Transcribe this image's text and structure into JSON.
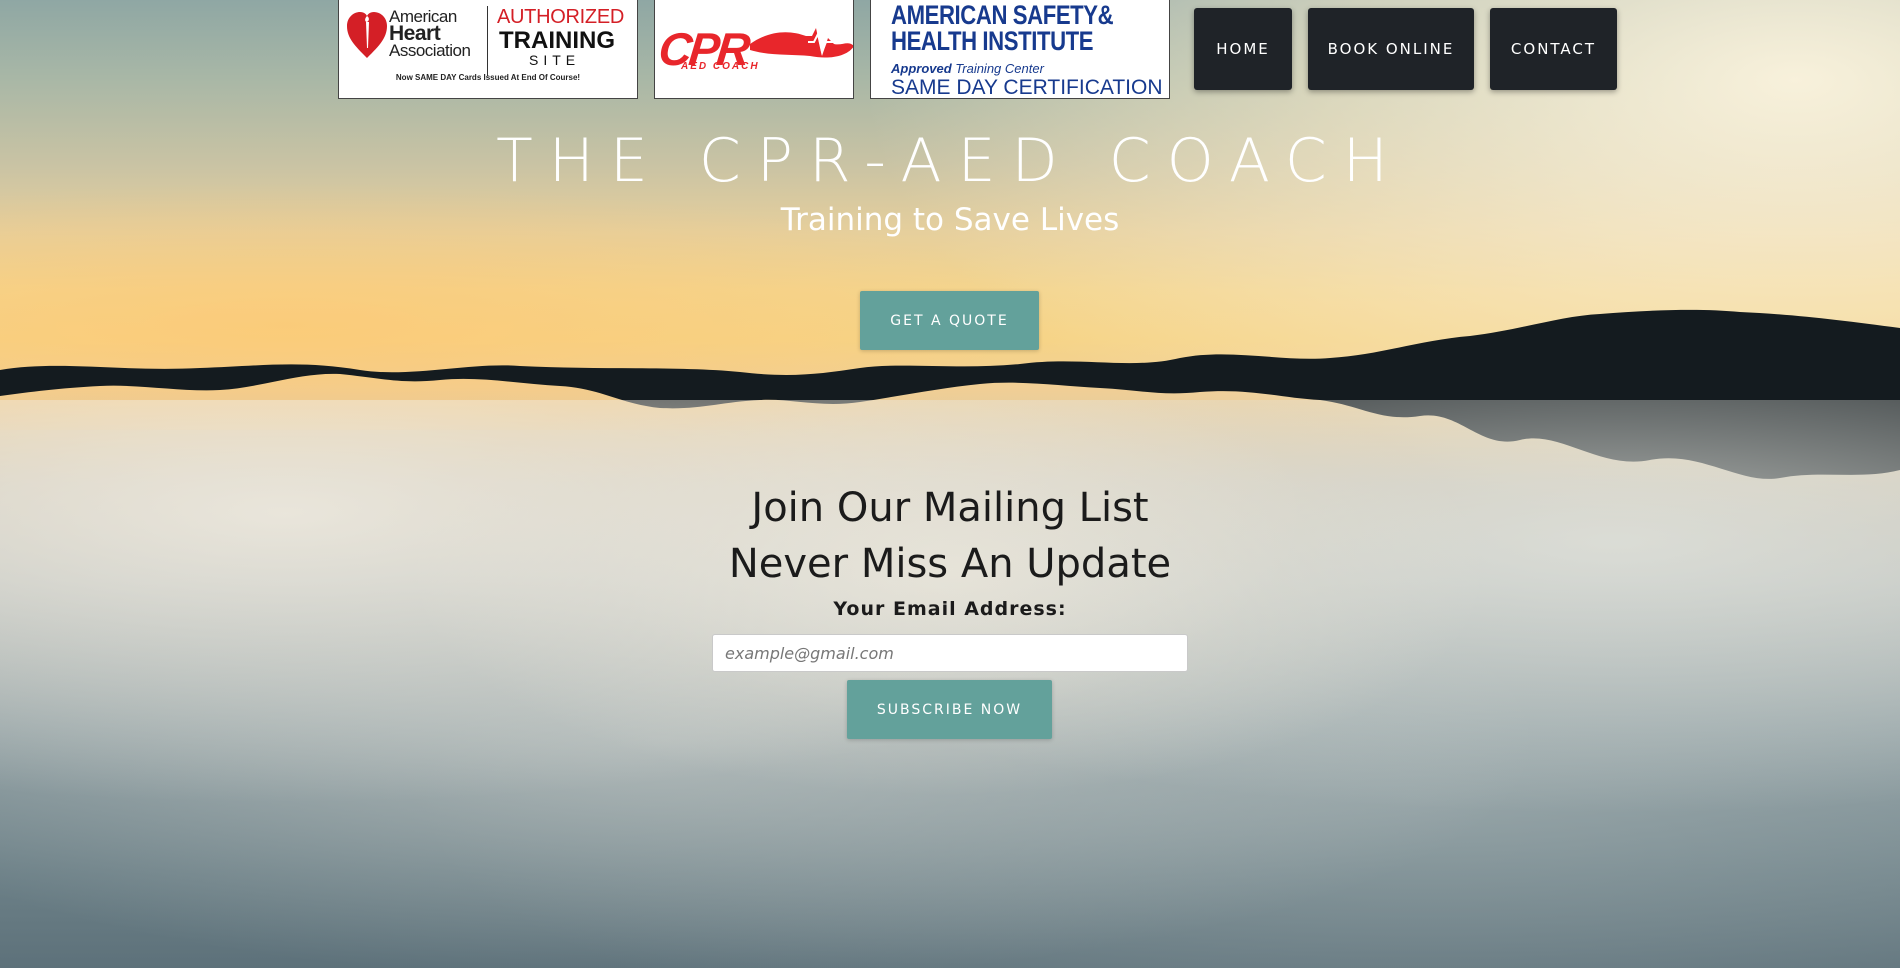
{
  "header": {
    "logos": {
      "aha": {
        "org_line1": "American",
        "org_line2": "Heart",
        "org_line3": "Association",
        "authorized": "AUTHORIZED",
        "training": "TRAINING",
        "site": "SITE",
        "note": "Now SAME DAY Cards Issued At End Of Course!"
      },
      "cpr": {
        "main": "CPR",
        "sub": "AED COACH"
      },
      "ashi": {
        "line1": "AMERICAN SAFETY&",
        "line2": "HEALTH INSTITUTE",
        "approved_word": "Approved",
        "approved_rest": " Training Center",
        "same_day": "SAME DAY CERTIFICATION"
      }
    },
    "nav": {
      "home": "HOME",
      "book_online": "BOOK ONLINE",
      "contact": "CONTACT"
    }
  },
  "hero": {
    "title": "THE CPR-AED COACH",
    "subtitle": "Training to Save Lives",
    "cta_label": "GET A QUOTE"
  },
  "mailing_list": {
    "heading_line1": "Join Our Mailing List",
    "heading_line2": "Never Miss An Update",
    "email_label": "Your Email Address:",
    "email_placeholder": "example@gmail.com",
    "email_value": "",
    "subscribe_label": "SUBSCRIBE NOW"
  },
  "colors": {
    "nav_bg": "#1f2328",
    "accent_teal": "#63a19b",
    "aha_red": "#d41f26",
    "ashi_blue": "#173a8e"
  }
}
